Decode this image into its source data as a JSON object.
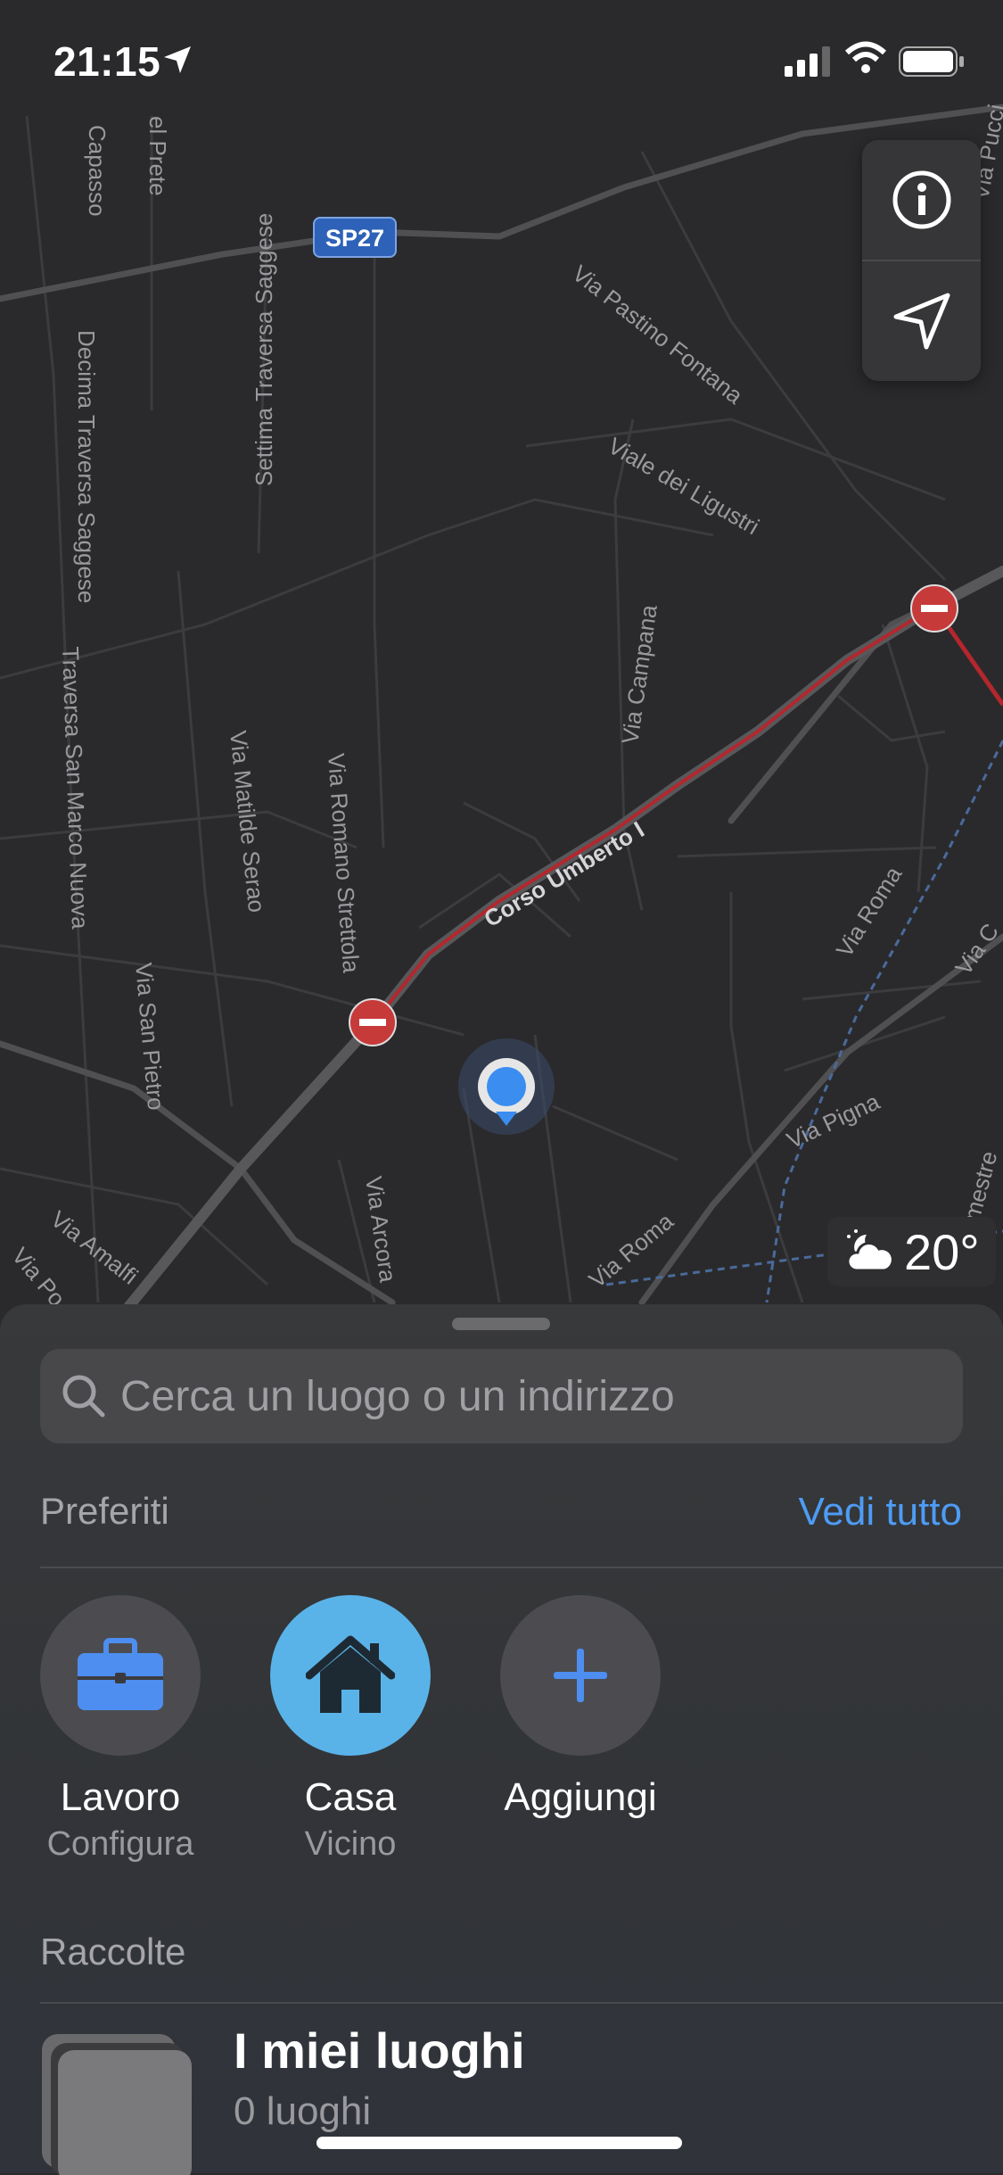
{
  "status": {
    "time": "21:15"
  },
  "map": {
    "road_labels": [
      "Capasso",
      "el Prete",
      "SP27",
      "Settima Traversa Saggese",
      "Decima Traversa Saggese",
      "Via Pastino Fontana",
      "Viale dei Ligustri",
      "Via Campana",
      "Traversa San Marco Nuova",
      "Via Matilde Serao",
      "Via Romano Strettola",
      "Corso Umberto I",
      "Via Roma",
      "Via San Pietro",
      "Via Pigna",
      "Via Amalfi",
      "Via Arcora",
      "Via Roma",
      "Via Po",
      "Via C",
      "mestre",
      "Via Pucci"
    ],
    "temperature": "20°"
  },
  "sheet": {
    "search_placeholder": "Cerca un luogo o un indirizzo",
    "favorites_title": "Preferiti",
    "see_all": "Vedi tutto",
    "favorites": [
      {
        "name": "Lavoro",
        "sub": "Configura",
        "icon": "briefcase-icon"
      },
      {
        "name": "Casa",
        "sub": "Vicino",
        "icon": "house-icon"
      },
      {
        "name": "Aggiungi",
        "sub": "",
        "icon": "plus-icon"
      }
    ],
    "collections_title": "Raccolte",
    "collection": {
      "name": "I miei luoghi",
      "count": "0 luoghi"
    }
  },
  "colors": {
    "accent": "#4d9cf5",
    "home": "#5ab3e8",
    "route": "#b3272d"
  }
}
